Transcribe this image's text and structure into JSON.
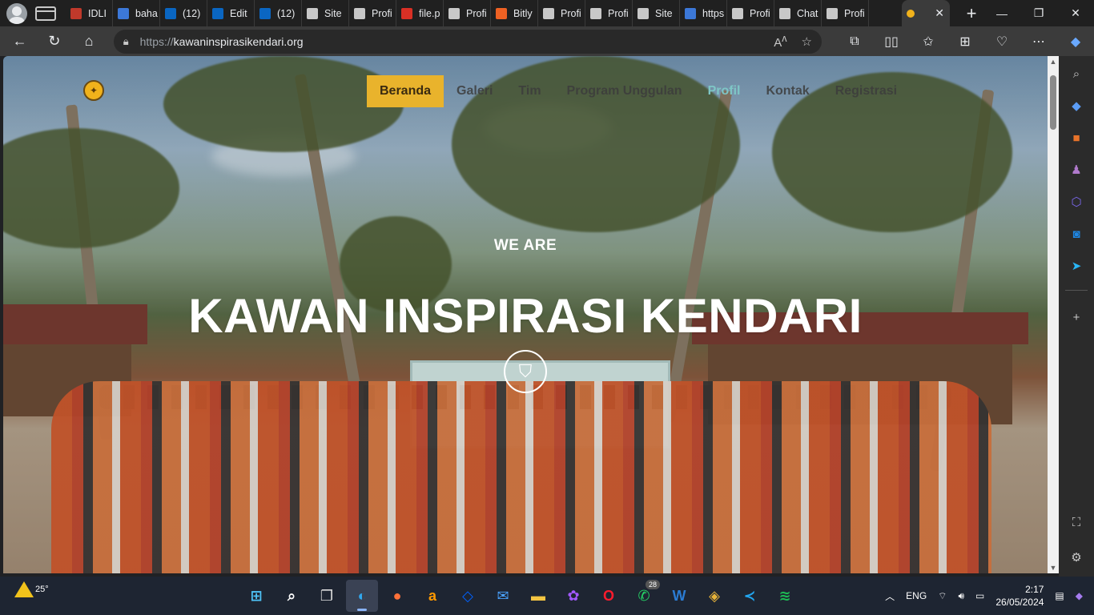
{
  "browser": {
    "tabs": [
      {
        "label": "IDLI",
        "color": "#c0392b"
      },
      {
        "label": "baha",
        "color": "#3c78d8"
      },
      {
        "label": "(12)",
        "color": "#0a66c2"
      },
      {
        "label": "Edit",
        "color": "#0a66c2"
      },
      {
        "label": "(12)",
        "color": "#0a66c2"
      },
      {
        "label": "Site",
        "color": "#c8c8c8"
      },
      {
        "label": "Profi",
        "color": "#c8c8c8"
      },
      {
        "label": "file.p",
        "color": "#d93025"
      },
      {
        "label": "Profi",
        "color": "#c8c8c8"
      },
      {
        "label": "Bitly",
        "color": "#ee6123"
      },
      {
        "label": "Profi",
        "color": "#c8c8c8"
      },
      {
        "label": "Profi",
        "color": "#c8c8c8"
      },
      {
        "label": "Site",
        "color": "#c8c8c8"
      },
      {
        "label": "https",
        "color": "#3c78d8"
      },
      {
        "label": "Profi",
        "color": "#c8c8c8"
      },
      {
        "label": "Chat",
        "color": "#c8c8c8"
      },
      {
        "label": "Profi",
        "color": "#c8c8c8"
      }
    ],
    "url": {
      "protocol": "https://",
      "host": "kawaninspirasikendari.org"
    }
  },
  "site": {
    "nav": [
      "Beranda",
      "Galeri",
      "Tim",
      "Program Unggulan",
      "Profil",
      "Kontak",
      "Registrasi"
    ],
    "hero_kicker": "WE ARE",
    "hero_title": "KAWAN INSPIRASI KENDARI"
  },
  "taskbar": {
    "weather_temp": "25°",
    "whatsapp_badge": "28",
    "language": "ENG",
    "time": "2:17",
    "date": "26/05/2024"
  },
  "colors": {
    "nav_active_bg": "#e9b32c",
    "nav_current": "#7ec6c6",
    "accent": "#8ab4f8"
  }
}
